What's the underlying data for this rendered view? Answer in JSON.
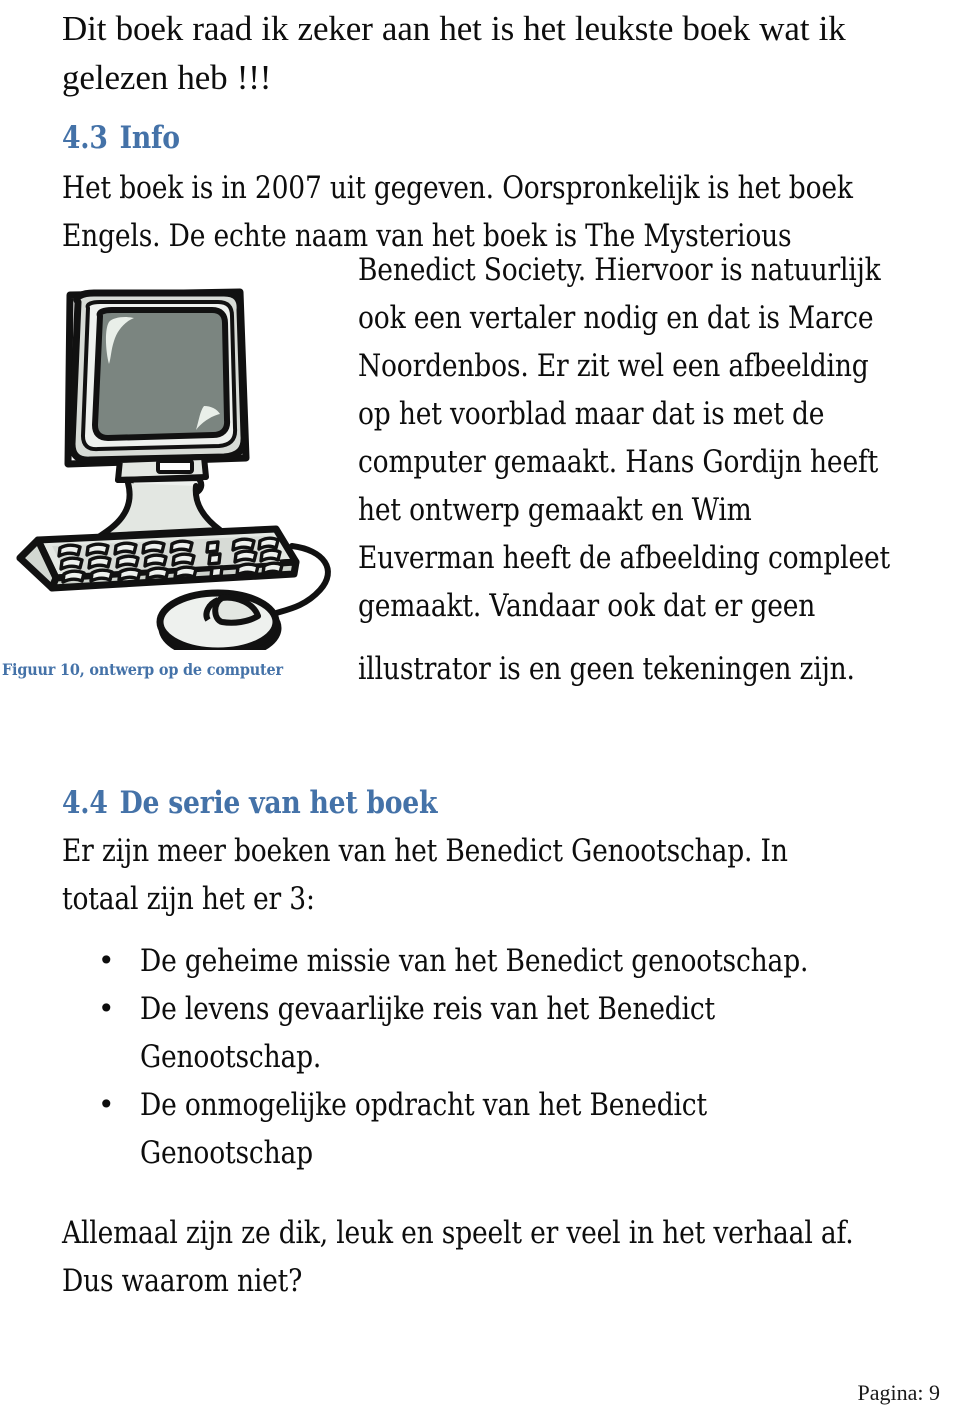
{
  "document": {
    "intro_paragraph": {
      "line1": "Dit boek raad ik zeker aan het is het leukste boek wat ik",
      "line2": "gelezen heb !!!"
    },
    "section_43": {
      "number": "4.3",
      "title": "Info",
      "lead_lines": [
        "Het boek is in 2007 uit gegeven. Oorspronkelijk is het boek",
        "Engels. De echte naam van het boek is The Mysterious"
      ],
      "wrapped_lines": [
        "Benedict Society. Hiervoor is natuurlijk",
        "ook een vertaler nodig en dat is Marce",
        "Noordenbos. Er zit wel een afbeelding",
        "op het voorblad maar dat is met de",
        "computer gemaakt. Hans Gordijn heeft",
        "het ontwerp gemaakt en Wim",
        "Euverman heeft de afbeelding compleet",
        "gemaakt. Vandaar ook dat er geen"
      ],
      "tail_line": "illustrator is en geen tekeningen zijn.",
      "figure": {
        "caption": "Figuur 10, ontwerp op de computer",
        "alt": "computer-clipart",
        "colors": {
          "outline": "#111111",
          "case": "#d7dbd6",
          "case_shade": "#c2c7c1",
          "screen": "#7b8580",
          "highlight": "#eef2ee"
        }
      }
    },
    "section_44": {
      "number": "4.4",
      "title": "De serie van het boek",
      "intro_lines": [
        "Er zijn meer boeken van het Benedict Genootschap. In",
        "totaal zijn het er 3:"
      ],
      "bullet_glyph": "•",
      "books": [
        {
          "lines": [
            "De geheime missie van het Benedict genootschap."
          ]
        },
        {
          "lines": [
            "De levens gevaarlijke reis van het Benedict",
            "Genootschap."
          ]
        },
        {
          "lines": [
            "De onmogelijke opdracht van het Benedict",
            "Genootschap"
          ]
        }
      ],
      "closing_lines": [
        "Allemaal zijn ze dik, leuk en speelt er veel in het verhaal af.",
        "Dus waarom niet?"
      ]
    },
    "footer": {
      "page_label": "Pagina: 9"
    },
    "colors": {
      "heading_blue": "#4472a8",
      "body_text": "#0d0d0d",
      "page_background": "#ffffff"
    }
  }
}
